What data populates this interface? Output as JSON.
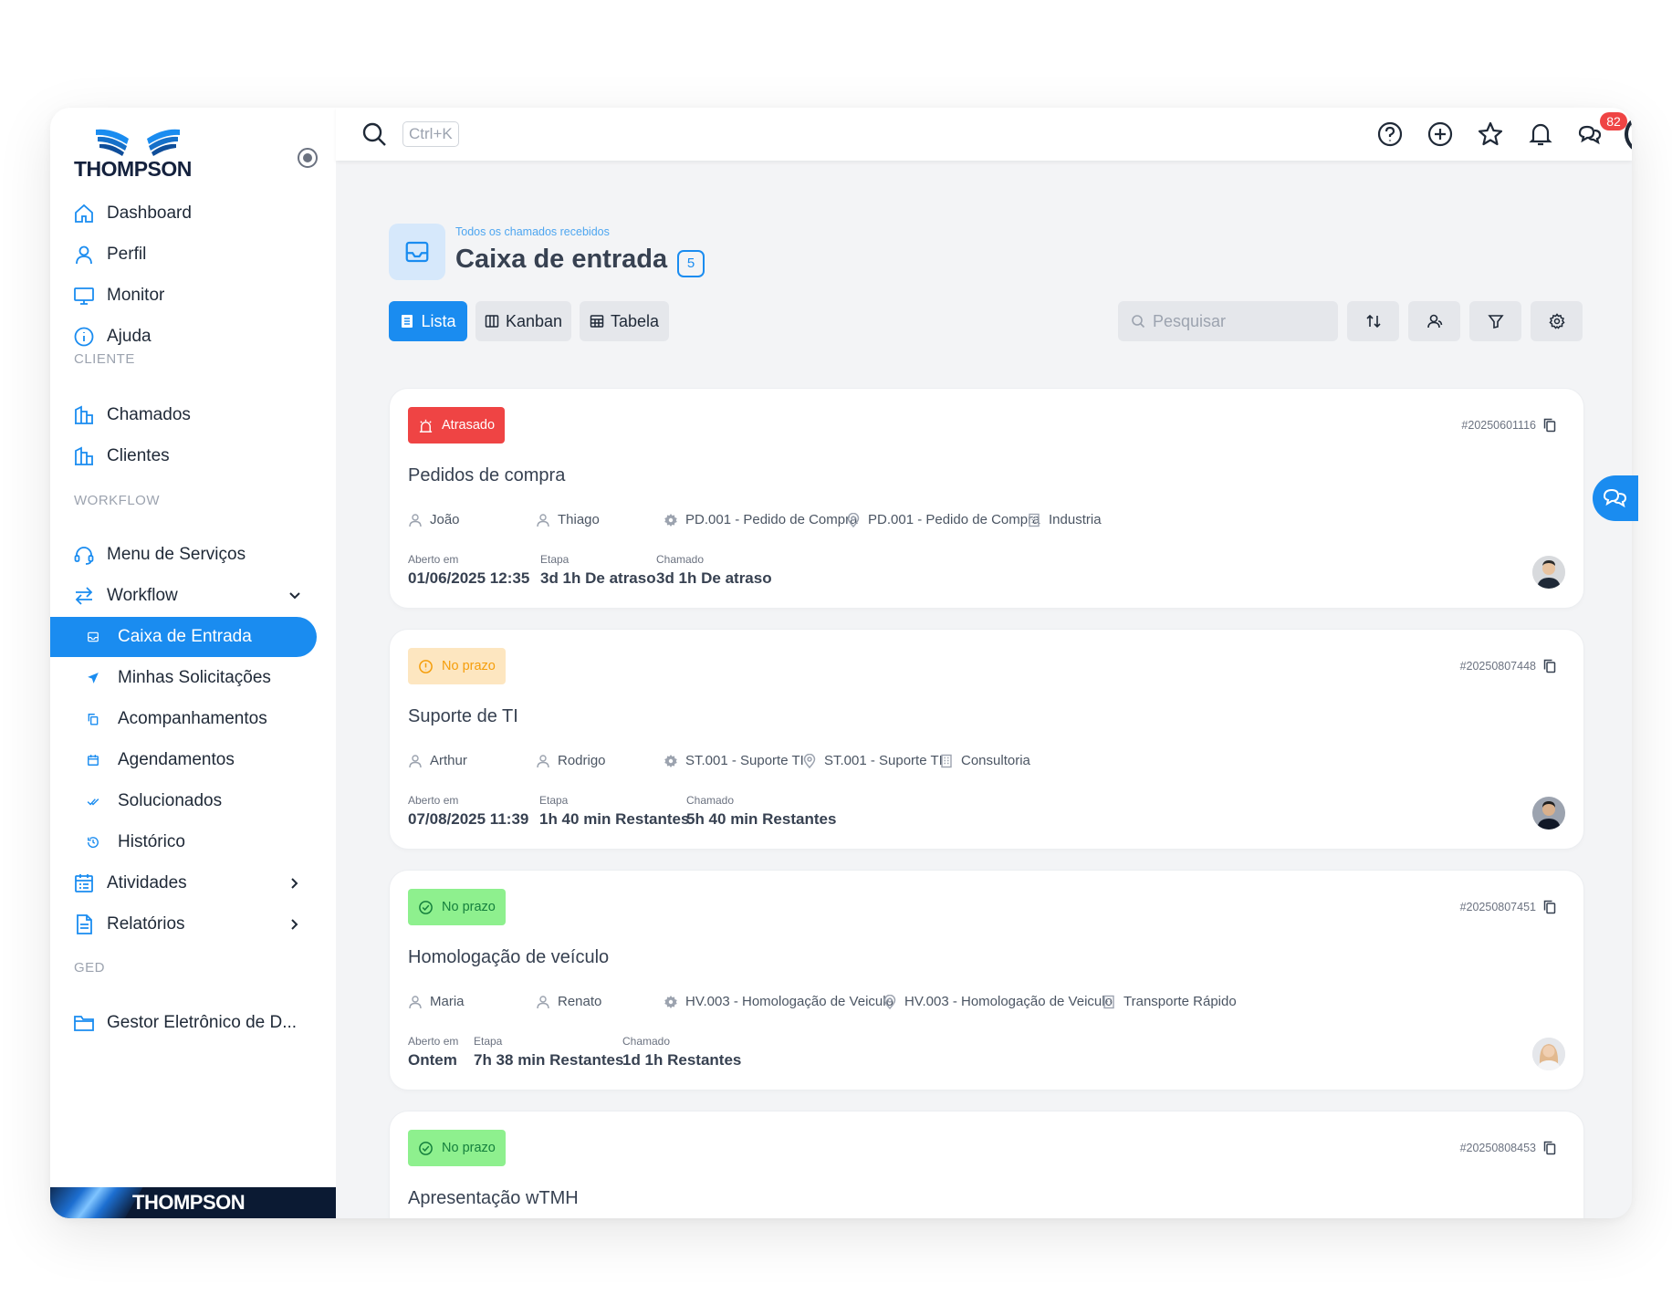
{
  "brand": {
    "name": "THOMPSON",
    "footer_name": "THOMPSON"
  },
  "sidebar": {
    "items": [
      {
        "label": "Dashboard"
      },
      {
        "label": "Perfil"
      },
      {
        "label": "Monitor"
      },
      {
        "label": "Ajuda"
      },
      {
        "label": "Chamados"
      },
      {
        "label": "Clientes"
      },
      {
        "label": "Menu de Serviços"
      },
      {
        "label": "Workflow"
      },
      {
        "label": "Caixa de Entrada"
      },
      {
        "label": "Minhas Solicitações"
      },
      {
        "label": "Acompanhamentos"
      },
      {
        "label": "Agendamentos"
      },
      {
        "label": "Solucionados"
      },
      {
        "label": "Histórico"
      },
      {
        "label": "Atividades"
      },
      {
        "label": "Relatórios"
      },
      {
        "label": "Gestor Eletrônico de D..."
      }
    ],
    "sections": {
      "cliente": "CLIENTE",
      "workflow": "WORKFLOW",
      "ged": "GED"
    }
  },
  "topbar": {
    "shortcut": "Ctrl+K",
    "notification_count": "82"
  },
  "page": {
    "breadcrumb": "Todos os chamados recebidos",
    "title": "Caixa de entrada",
    "count": "5"
  },
  "views": {
    "list": "Lista",
    "kanban": "Kanban",
    "table": "Tabela"
  },
  "search": {
    "placeholder": "Pesquisar"
  },
  "field_labels": {
    "opened": "Aberto em",
    "stage": "Etapa",
    "ticket": "Chamado"
  },
  "cards": [
    {
      "status": "Atrasado",
      "id": "#20250601116",
      "title": "Pedidos de compra",
      "requester": "João",
      "assignee": "Thiago",
      "service": "PD.001 - Pedido de Compra",
      "location": "PD.001 - Pedido de Compra",
      "company": "Industria",
      "opened": "01/06/2025 12:35",
      "stage": "3d 1h De atraso",
      "ticket": "3d 1h De atraso"
    },
    {
      "status": "No prazo",
      "id": "#20250807448",
      "title": "Suporte de TI",
      "requester": "Arthur",
      "assignee": "Rodrigo",
      "service": "ST.001 - Suporte TI",
      "location": "ST.001 - Suporte TI",
      "company": "Consultoria",
      "opened": "07/08/2025 11:39",
      "stage": "1h 40 min Restantes",
      "ticket": "5h 40 min Restantes"
    },
    {
      "status": "No prazo",
      "id": "#20250807451",
      "title": "Homologação de veículo",
      "requester": "Maria",
      "assignee": "Renato",
      "service": "HV.003 - Homologação de Veiculo",
      "location": "HV.003 - Homologação de Veiculo",
      "company": "Transporte Rápido",
      "opened": "Ontem",
      "stage": "7h 38 min Restantes",
      "ticket": "1d 1h Restantes"
    },
    {
      "status": "No prazo",
      "id": "#20250808453",
      "title": "Apresentação wTMH"
    }
  ],
  "colors": {
    "accent": "#1a8cf0",
    "late": "#ef4444",
    "warn_bg": "#fde6c0",
    "ok_bg": "#8ef08e"
  }
}
